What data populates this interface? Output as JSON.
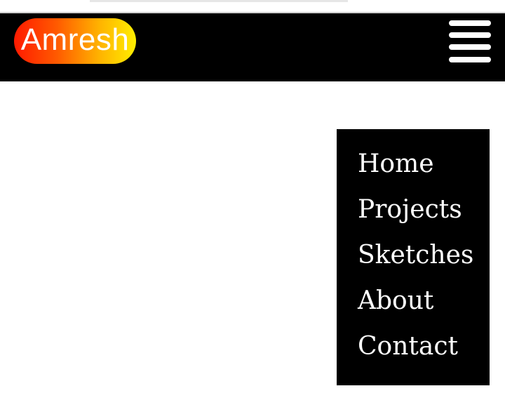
{
  "header": {
    "logo_text": "Amresh",
    "logo_gradient": [
      "#ff1a00",
      "#ff5a00",
      "#ffb300",
      "#ffee00"
    ],
    "menu_icon": "hamburger-menu-icon",
    "background": "#000000"
  },
  "nav_menu": {
    "items": [
      {
        "label": "Home"
      },
      {
        "label": "Projects"
      },
      {
        "label": "Sketches"
      },
      {
        "label": "About"
      },
      {
        "label": "Contact"
      }
    ],
    "background": "#000000",
    "text_color": "#ffffff"
  }
}
